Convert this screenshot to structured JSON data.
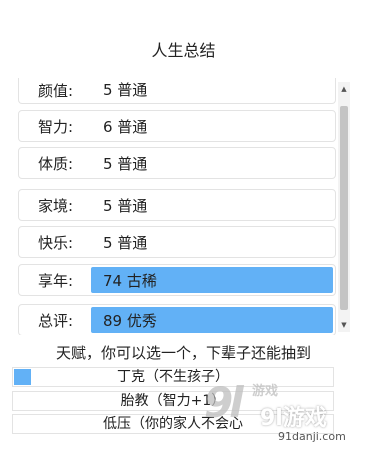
{
  "page": {
    "title": "人生总结"
  },
  "summary": {
    "rows": [
      {
        "label": "颜值:",
        "value": "5 普通",
        "highlighted": false
      },
      {
        "label": "智力:",
        "value": "6 普通",
        "highlighted": false
      },
      {
        "label": "体质:",
        "value": "5 普通",
        "highlighted": false
      },
      {
        "label": "家境:",
        "value": "5 普通",
        "highlighted": false
      },
      {
        "label": "快乐:",
        "value": "5 普通",
        "highlighted": false
      },
      {
        "label": "享年:",
        "value": "74 古稀",
        "highlighted": true
      },
      {
        "label": "总评:",
        "value": "89 优秀",
        "highlighted": true
      }
    ]
  },
  "talents": {
    "hint": "天赋，你可以选一个，下辈子还能抽到",
    "items": [
      {
        "text": "丁克（不生孩子）",
        "selected": true
      },
      {
        "text": "胎教（智力+1）",
        "selected": false
      },
      {
        "text": "低压（你的家人不会心",
        "selected": false
      }
    ]
  },
  "watermark": {
    "logo": "9l",
    "small": "游戏",
    "brand": "9l游戏",
    "url": "91danji.com"
  },
  "colors": {
    "highlight": "#62b1f6",
    "border": "#e3e3e3",
    "scrollbar_thumb": "#c4c4c4"
  },
  "icons": {
    "scroll_up": "scroll-up-arrow-icon",
    "scroll_down": "scroll-down-arrow-icon"
  }
}
